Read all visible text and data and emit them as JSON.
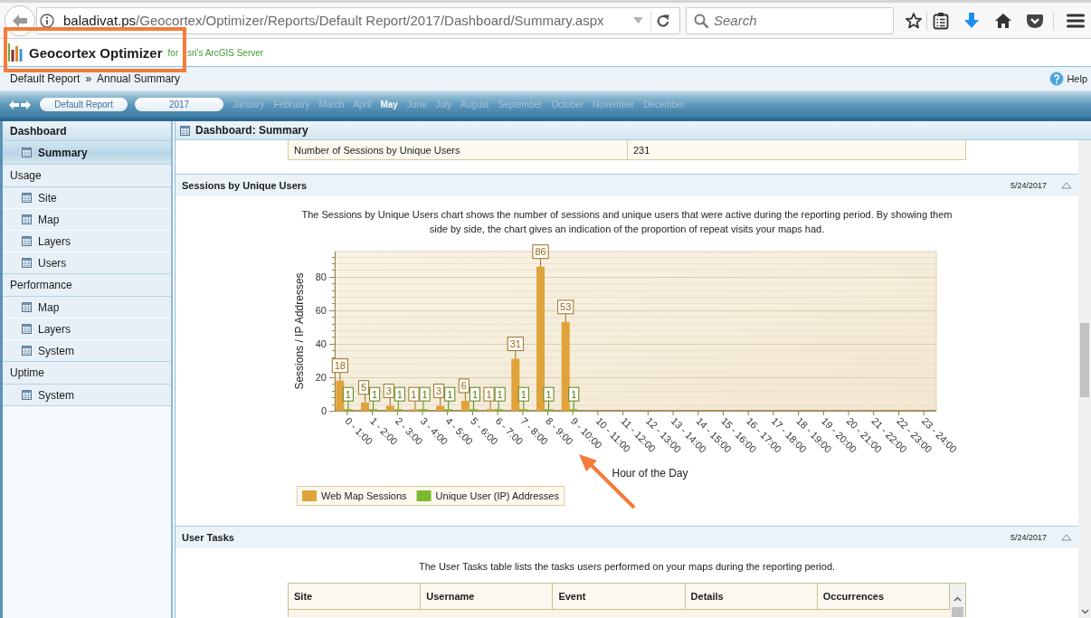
{
  "browser": {
    "address": {
      "host": "baladivat.ps",
      "path": "/Geocortex/Optimizer/Reports/Default Report/2017/Dashboard/Summary.aspx"
    },
    "search": {
      "placeholder": "Search"
    }
  },
  "app_header": {
    "title": "Geocortex Optimizer",
    "tagline_parts": [
      "for",
      "sri's ArcGIS Server"
    ],
    "annotation": {
      "kind": "box"
    }
  },
  "breadcrumb": {
    "items": [
      "Default Report",
      "Annual Summary"
    ],
    "separator": "»",
    "help": "Help"
  },
  "date_nav": {
    "report": "Default Report",
    "year": "2017",
    "months": [
      {
        "label": "January",
        "selected": false
      },
      {
        "label": "February",
        "selected": false
      },
      {
        "label": "March",
        "selected": false
      },
      {
        "label": "April",
        "selected": false
      },
      {
        "label": "May",
        "selected": true
      },
      {
        "label": "June",
        "selected": false
      },
      {
        "label": "July",
        "selected": false
      },
      {
        "label": "August",
        "selected": false
      },
      {
        "label": "September",
        "selected": false
      },
      {
        "label": "October",
        "selected": false
      },
      {
        "label": "November",
        "selected": false
      },
      {
        "label": "December",
        "selected": false
      }
    ]
  },
  "sidebar": {
    "groups": [
      {
        "label": "Dashboard",
        "selected": true,
        "children": [
          {
            "label": "Summary",
            "selected": true
          }
        ]
      },
      {
        "label": "Usage",
        "selected": false,
        "children": [
          {
            "label": "Site",
            "selected": false
          },
          {
            "label": "Map",
            "selected": false
          },
          {
            "label": "Layers",
            "selected": false
          },
          {
            "label": "Users",
            "selected": false
          }
        ]
      },
      {
        "label": "Performance",
        "selected": false,
        "children": [
          {
            "label": "Map",
            "selected": false
          },
          {
            "label": "Layers",
            "selected": false
          },
          {
            "label": "System",
            "selected": false
          }
        ]
      },
      {
        "label": "Uptime",
        "selected": false,
        "children": [
          {
            "label": "System",
            "selected": false
          }
        ]
      }
    ]
  },
  "main": {
    "title": "Dashboard: Summary",
    "summary_row": {
      "label": "Number of Sessions by Unique Users",
      "value": "231"
    },
    "sections": [
      {
        "kind": "chart",
        "title": "Sessions by Unique Users",
        "date": "5/24/2017",
        "expanded": true,
        "description": "The Sessions by Unique Users chart shows the number of sessions and unique users that were active during the reporting period. By showing them side by side, the chart gives an indication of the proportion of repeat visits your maps had.",
        "annotation": {
          "kind": "arrow"
        },
        "chart_data": {
          "type": "bar",
          "xlabel": "Hour of the Day",
          "ylabel": "Sessions / IP Addresses",
          "categories": [
            "0 - 1:00",
            "1 - 2:00",
            "2 - 3:00",
            "3 - 4:00",
            "4 - 5:00",
            "5 - 6:00",
            "6 - 7:00",
            "7 - 8:00",
            "8 - 9:00",
            "9 - 10:00",
            "10 - 11:00",
            "11 - 12:00",
            "12 - 13:00",
            "13 - 14:00",
            "14 - 15:00",
            "15 - 16:00",
            "16 - 17:00",
            "17 - 18:00",
            "18 - 19:00",
            "19 - 20:00",
            "20 - 21:00",
            "21 - 22:00",
            "22 - 23:00",
            "23 - 24:00"
          ],
          "series": [
            {
              "name": "Web Map Sessions",
              "color": "#e0a33a",
              "values": [
                18,
                5,
                3,
                1,
                3,
                6,
                1,
                31,
                86,
                53,
                0,
                0,
                0,
                0,
                0,
                0,
                0,
                0,
                0,
                0,
                0,
                0,
                0,
                0
              ]
            },
            {
              "name": "Unique User (IP) Addresses",
              "color": "#7cba2d",
              "values": [
                1,
                1,
                1,
                1,
                1,
                1,
                1,
                1,
                1,
                1,
                0,
                0,
                0,
                0,
                0,
                0,
                0,
                0,
                0,
                0,
                0,
                0,
                0,
                0
              ]
            }
          ],
          "ylim": [
            0,
            95
          ],
          "yticks": [
            0,
            20,
            40,
            60,
            80
          ],
          "grid": true,
          "legend": true,
          "value_labels": [
            [
              "18",
              "5",
              "3",
              "1",
              "3",
              "6",
              "1",
              "31",
              "86",
              "53",
              null,
              null,
              null,
              null,
              null,
              null,
              null,
              null,
              null,
              null,
              null,
              null,
              null,
              null
            ],
            [
              "1",
              "1",
              "1",
              "1",
              "1",
              "1",
              "1",
              "1",
              "1",
              "1",
              null,
              null,
              null,
              null,
              null,
              null,
              null,
              null,
              null,
              null,
              null,
              null,
              null,
              null
            ]
          ]
        }
      },
      {
        "kind": "table",
        "title": "User Tasks",
        "date": "5/24/2017",
        "expanded": true,
        "description": "The User Tasks table lists the tasks users performed on your maps during the reporting period.",
        "table": {
          "columns": [
            "Site",
            "Username",
            "Event",
            "Details",
            "Occurrences"
          ]
        }
      }
    ]
  }
}
